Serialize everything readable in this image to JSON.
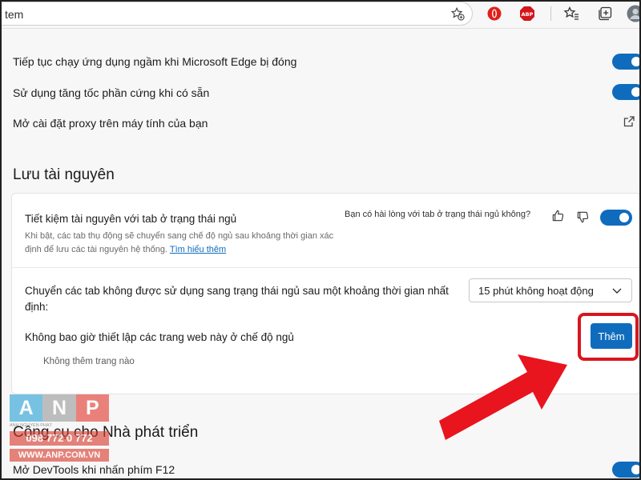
{
  "address_bar": {
    "url_text": "tem"
  },
  "general": {
    "rows": [
      {
        "label": "Tiếp tục chạy ứng dụng ngầm khi Microsoft Edge bị đóng"
      },
      {
        "label": "Sử dụng tăng tốc phần cứng khi có sẵn"
      },
      {
        "label": "Mở cài đặt proxy trên máy tính của bạn"
      }
    ]
  },
  "save_resources": {
    "title": "Lưu tài nguyên",
    "sleeping_tabs": {
      "label": "Tiết kiệm tài nguyên với tab ở trạng thái ngủ",
      "description": "Khi bật, các tab thụ động sẽ chuyển sang chế độ ngủ sau khoảng thời gian xác định để lưu các tài nguyên hệ thống.",
      "learn_more": "Tìm hiểu thêm",
      "feedback_question": "Bạn có hài lòng với tab ở trạng thái ngủ không?"
    },
    "sleep_after": {
      "label": "Chuyển các tab không được sử dụng sang trạng thái ngủ sau một khoảng thời gian nhất định:",
      "selected": "15 phút không hoạt động"
    },
    "never_sleep": {
      "label": "Không bao giờ thiết lập các trang web này ở chế độ ngủ",
      "add_label": "Thêm",
      "empty_text": "Không thêm trang nào"
    }
  },
  "developer": {
    "title": "Công cụ cho Nhà phát triển",
    "row_label": "Mở DevTools khi nhấn phím F12"
  },
  "watermark": {
    "letters": [
      "A",
      "N",
      "P"
    ],
    "subtitle": "ANH NGUYÊN PHÁT",
    "phone": "098 772 0 772",
    "website": "WWW.ANP.COM.VN"
  },
  "colors": {
    "accent": "#0f6cbd",
    "highlight": "#d8161f",
    "arrow": "#e8141e"
  },
  "icons": [
    "favorites-add-icon",
    "opera-icon",
    "adblock-plus-icon",
    "favorites-icon",
    "collections-icon",
    "profile-avatar-icon",
    "external-link-icon",
    "thumbs-up-icon",
    "thumbs-down-icon",
    "chevron-down-icon"
  ]
}
